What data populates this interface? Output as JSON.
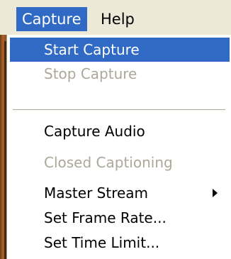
{
  "menubar": {
    "items": [
      {
        "label": "Capture",
        "state": "open"
      },
      {
        "label": "Help",
        "state": "normal"
      }
    ]
  },
  "capture_menu": {
    "items": [
      {
        "label": "Start Capture",
        "state": "highlighted"
      },
      {
        "label": "Stop Capture",
        "state": "disabled"
      },
      {
        "label": "Capture Audio",
        "state": "enabled"
      },
      {
        "label": "Closed Captioning",
        "state": "disabled"
      },
      {
        "label": "Master Stream",
        "state": "enabled",
        "submenu": true
      },
      {
        "label": "Set Frame Rate...",
        "state": "enabled"
      },
      {
        "label": "Set Time Limit...",
        "state": "enabled"
      }
    ]
  },
  "colors": {
    "highlight": "#316ac5",
    "menubar_background": "#ece9d8",
    "disabled_text": "#aca899"
  },
  "icons": {
    "submenu": "triangle-right"
  }
}
